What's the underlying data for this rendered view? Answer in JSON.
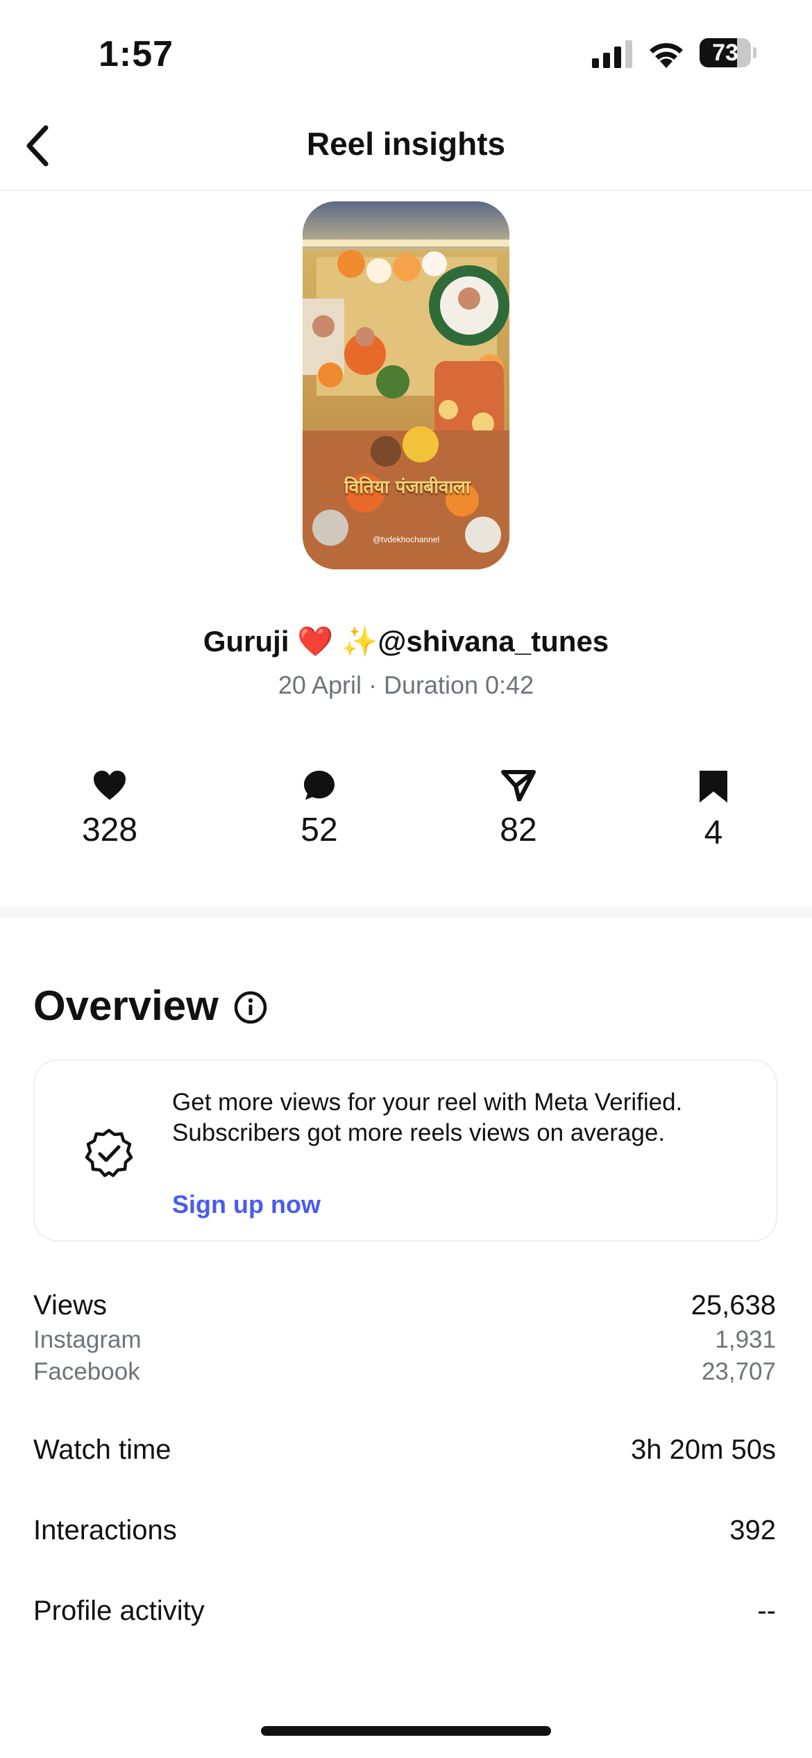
{
  "status_bar": {
    "time": "1:57",
    "battery_level": "73"
  },
  "header": {
    "title": "Reel insights"
  },
  "reel": {
    "caption": "Guruji ❤️ ✨@shivana_tunes",
    "meta": "20 April · Duration 0:42",
    "thumbnail_overlay_text": "वितिया पंजाबीवाला",
    "thumbnail_watermark": "@tvdekhochannel"
  },
  "stats": {
    "likes": "328",
    "comments": "52",
    "shares": "82",
    "saves": "4"
  },
  "overview": {
    "title": "Overview",
    "promo": {
      "text": "Get more views for your reel with Meta Verified. Subscribers got more reels views on average.",
      "link": "Sign up now"
    },
    "metrics": {
      "views_label": "Views",
      "views_value": "25,638",
      "instagram_label": "Instagram",
      "instagram_value": "1,931",
      "facebook_label": "Facebook",
      "facebook_value": "23,707",
      "watch_time_label": "Watch time",
      "watch_time_value": "3h 20m 50s",
      "interactions_label": "Interactions",
      "interactions_value": "392",
      "profile_activity_label": "Profile activity",
      "profile_activity_value": "--"
    }
  },
  "colors": {
    "accent_link": "#4a5bf0",
    "muted_text": "#6f7378"
  }
}
